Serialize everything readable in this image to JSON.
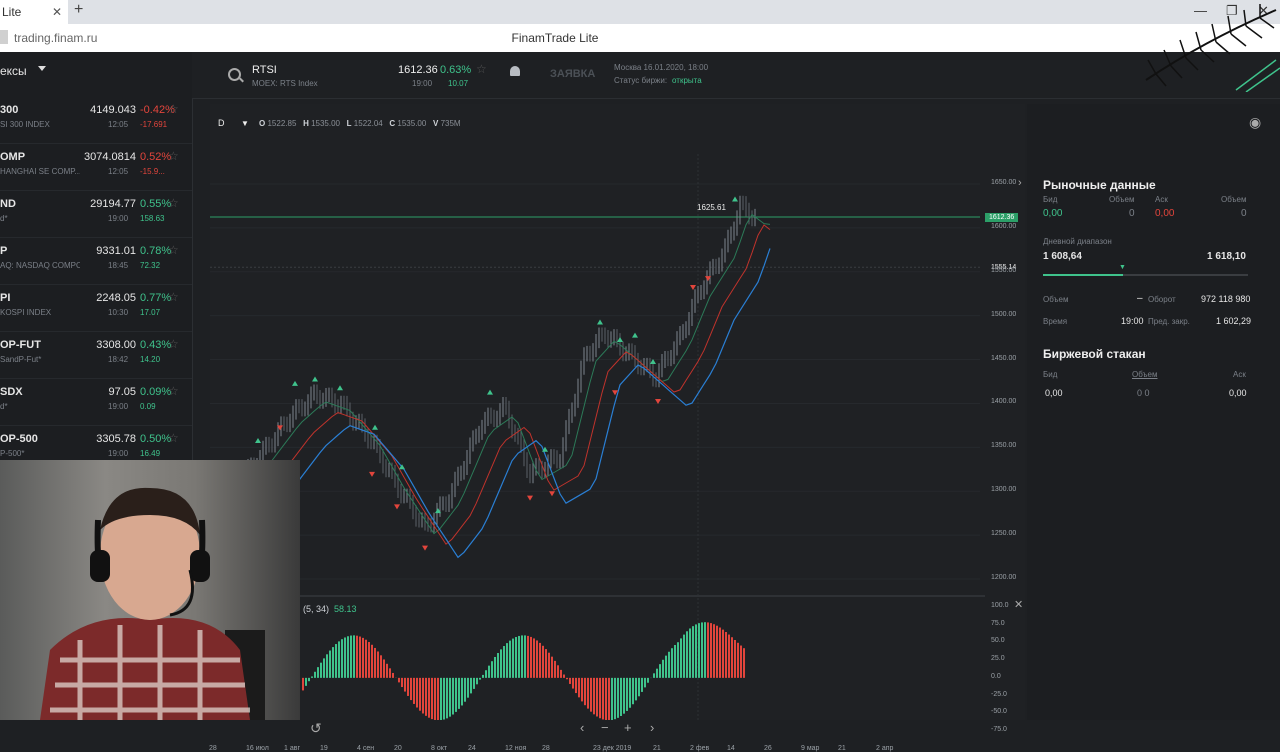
{
  "browser": {
    "tab_title": "Lite",
    "url": "trading.finam.ru",
    "page_title": "FinamTrade Lite"
  },
  "sidebar": {
    "header": "ексы",
    "items": [
      {
        "t": "300",
        "s": "SI 300 INDEX",
        "p": "4149.043",
        "ch": "-0.42%",
        "tm": "12:05",
        "pt": "-17.691",
        "dir": "neg"
      },
      {
        "t": "OMP",
        "s": "HANGHAI SE COMP...",
        "p": "3074.0814",
        "ch": "0.52%",
        "tm": "12:05",
        "pt": "-15.9...",
        "dir": "neg2"
      },
      {
        "t": "ND",
        "s": "d*",
        "p": "29194.77",
        "ch": "0.55%",
        "tm": "19:00",
        "pt": "158.63",
        "dir": "pos"
      },
      {
        "t": "P",
        "s": "AQ: NASDAQ COMPOSIT...",
        "p": "9331.01",
        "ch": "0.78%",
        "tm": "18:45",
        "pt": "72.32",
        "dir": "pos"
      },
      {
        "t": "PI",
        "s": "KOSPI INDEX",
        "p": "2248.05",
        "ch": "0.77%",
        "tm": "10:30",
        "pt": "17.07",
        "dir": "pos"
      },
      {
        "t": "OP-FUT",
        "s": "SandP-Fut*",
        "p": "3308.00",
        "ch": "0.43%",
        "tm": "18:42",
        "pt": "14.20",
        "dir": "pos"
      },
      {
        "t": "SDX",
        "s": "d*",
        "p": "97.05",
        "ch": "0.09%",
        "tm": "19:00",
        "pt": "0.09",
        "dir": "pos"
      },
      {
        "t": "OP-500",
        "s": "P-500*",
        "p": "3305.78",
        "ch": "0.50%",
        "tm": "19:00",
        "pt": "16.49",
        "dir": "pos"
      }
    ]
  },
  "topbar": {
    "symbol": "RTSI",
    "exchange": "MOEX: RTS Index",
    "price": "1612.36",
    "change_pct": "0.63%",
    "time": "19:00",
    "change_pts": "10.07",
    "order_label": "ЗАЯВКА",
    "session_time": "Москва 16.01.2020, 18:00",
    "status_label": "Статус биржи:",
    "status_value": "открыта"
  },
  "chart": {
    "timeframe": "D",
    "ohlcv": {
      "O": "1522.85",
      "H": "1535.00",
      "L": "1522.04",
      "C": "1535.00",
      "V": "735M"
    },
    "high_label": "1625.61",
    "current_price": "1612.36",
    "ref_price": "1555.14",
    "indicator_label": "(5, 34)",
    "indicator_value": "58.13",
    "yticks": [
      "1650.00",
      "1600.00",
      "1550.00",
      "1500.00",
      "1450.00",
      "1400.00",
      "1350.00",
      "1300.00",
      "1250.00",
      "1200.00"
    ],
    "osc_ticks": [
      "100.0",
      "75.0",
      "50.0",
      "25.0",
      "0.0",
      "-25.0",
      "-50.0",
      "-75.0"
    ],
    "xticks": [
      "28",
      "16 июл",
      "1 авг",
      "19",
      "4 сен",
      "20",
      "8 окт",
      "24",
      "12 ноя",
      "28",
      "23 дек 2019",
      "21",
      "2 фев",
      "14",
      "26",
      "9 мар",
      "21",
      "2 апр"
    ],
    "colors": {
      "up": "#3fc38c",
      "down": "#e2453c",
      "ma_red": "#c0332c",
      "ma_blue": "#2a7fd4",
      "ma_green": "#2c7a58"
    }
  },
  "right_panel": {
    "market_title": "Рыночные данные",
    "bid_label": "Бид",
    "vol_label": "Объем",
    "ask_label": "Аск",
    "vol2_label": "Объем",
    "bid": "0,00",
    "bid_vol": "0",
    "ask": "0,00",
    "ask_vol": "0",
    "range_label": "Дневной диапазон",
    "range_low": "1 608,64",
    "range_high": "1 618,10",
    "volume_label": "Объем",
    "volume_value": "–",
    "turnover_label": "Оборот",
    "turnover_value": "972 118 980",
    "time_label": "Время",
    "time_value": "19:00",
    "prev_close_label": "Пред. закр.",
    "prev_close_value": "1 602,29",
    "book_title": "Биржевой стакан",
    "book_bid": "Бид",
    "book_vol": "Объем",
    "book_ask": "Аск",
    "book_bid_val": "0,00",
    "book_vol_val": "0  0",
    "book_ask_val": "0,00"
  }
}
